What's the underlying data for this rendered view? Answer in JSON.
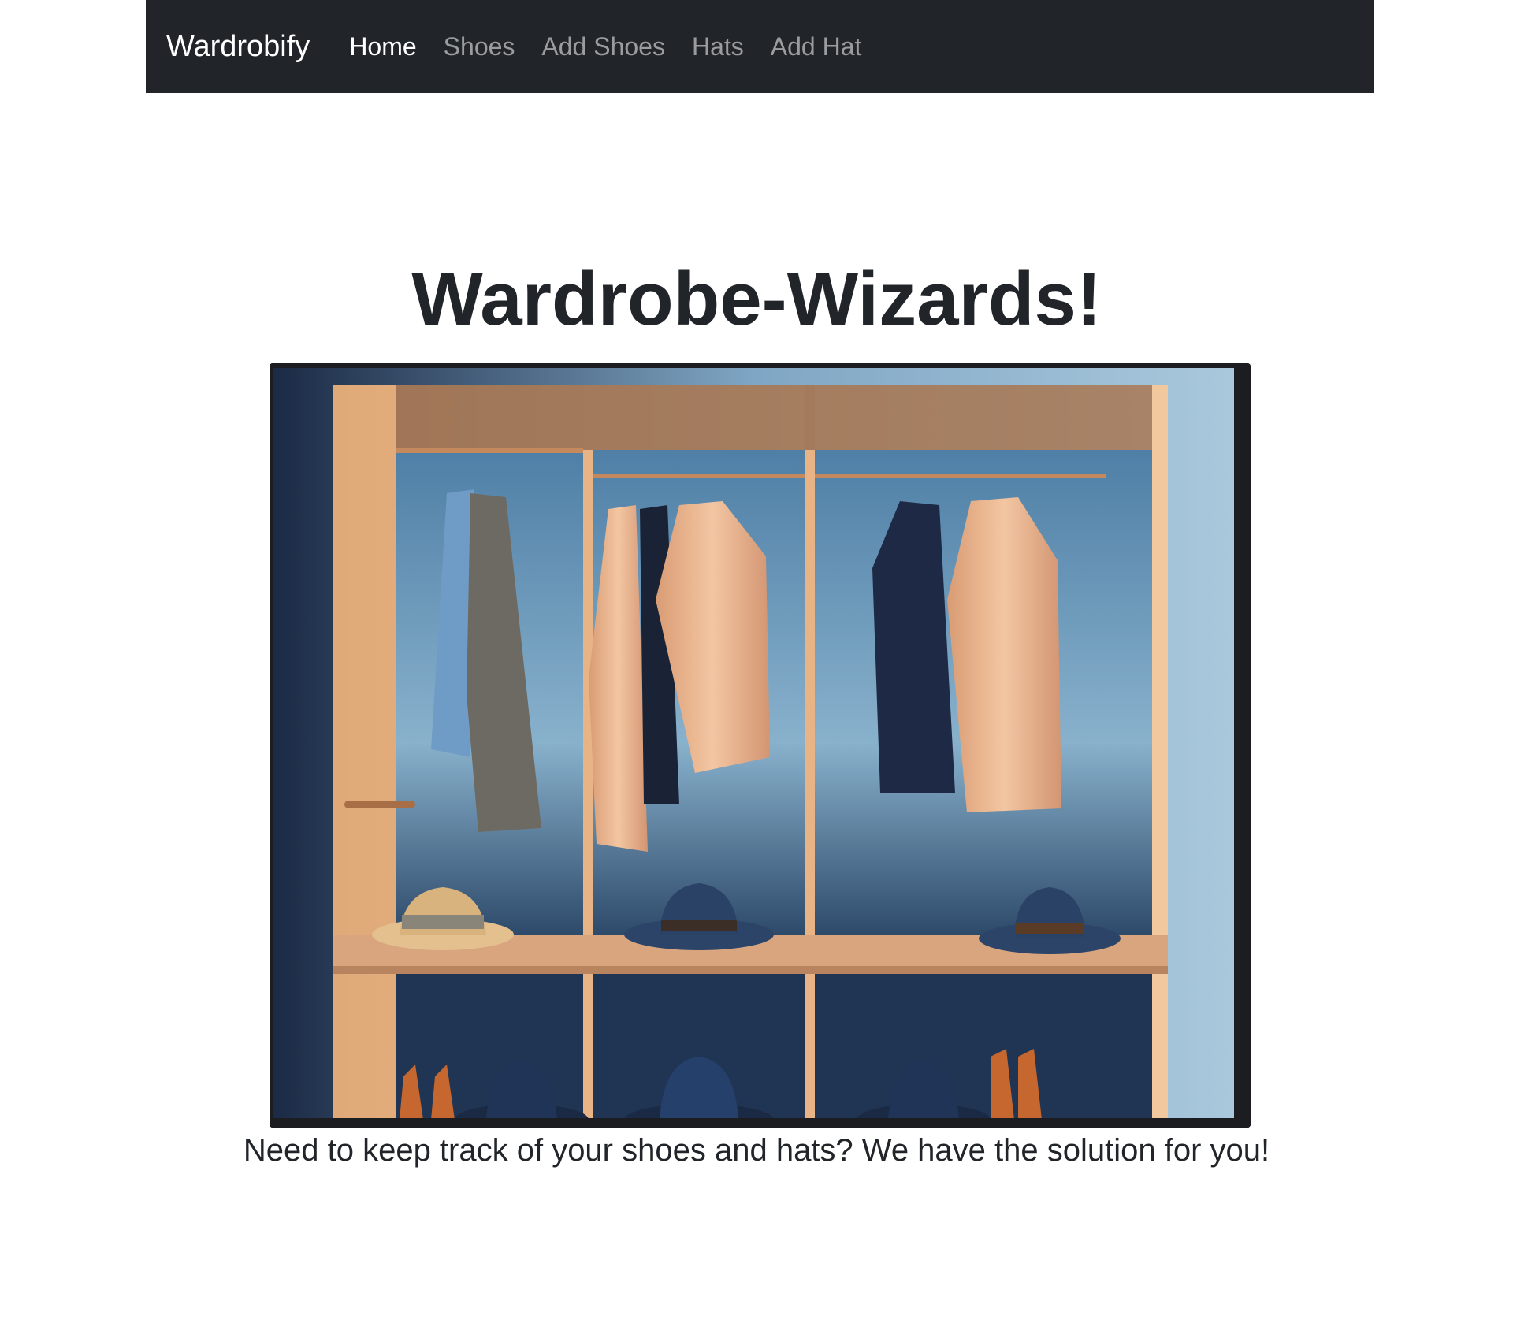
{
  "navbar": {
    "brand": "Wardrobify",
    "links": [
      {
        "label": "Home",
        "active": true
      },
      {
        "label": "Shoes",
        "active": false
      },
      {
        "label": "Add Shoes",
        "active": false
      },
      {
        "label": "Hats",
        "active": false
      },
      {
        "label": "Add Hat",
        "active": false
      }
    ]
  },
  "main": {
    "title": "Wardrobe-Wizards!",
    "tagline": "Need to keep track of your shoes and hats? We have the solution for you!"
  },
  "colors": {
    "navbar_bg": "#212529",
    "text_primary": "#212529",
    "nav_active": "#ffffff",
    "nav_inactive": "rgba(255,255,255,0.55)"
  }
}
